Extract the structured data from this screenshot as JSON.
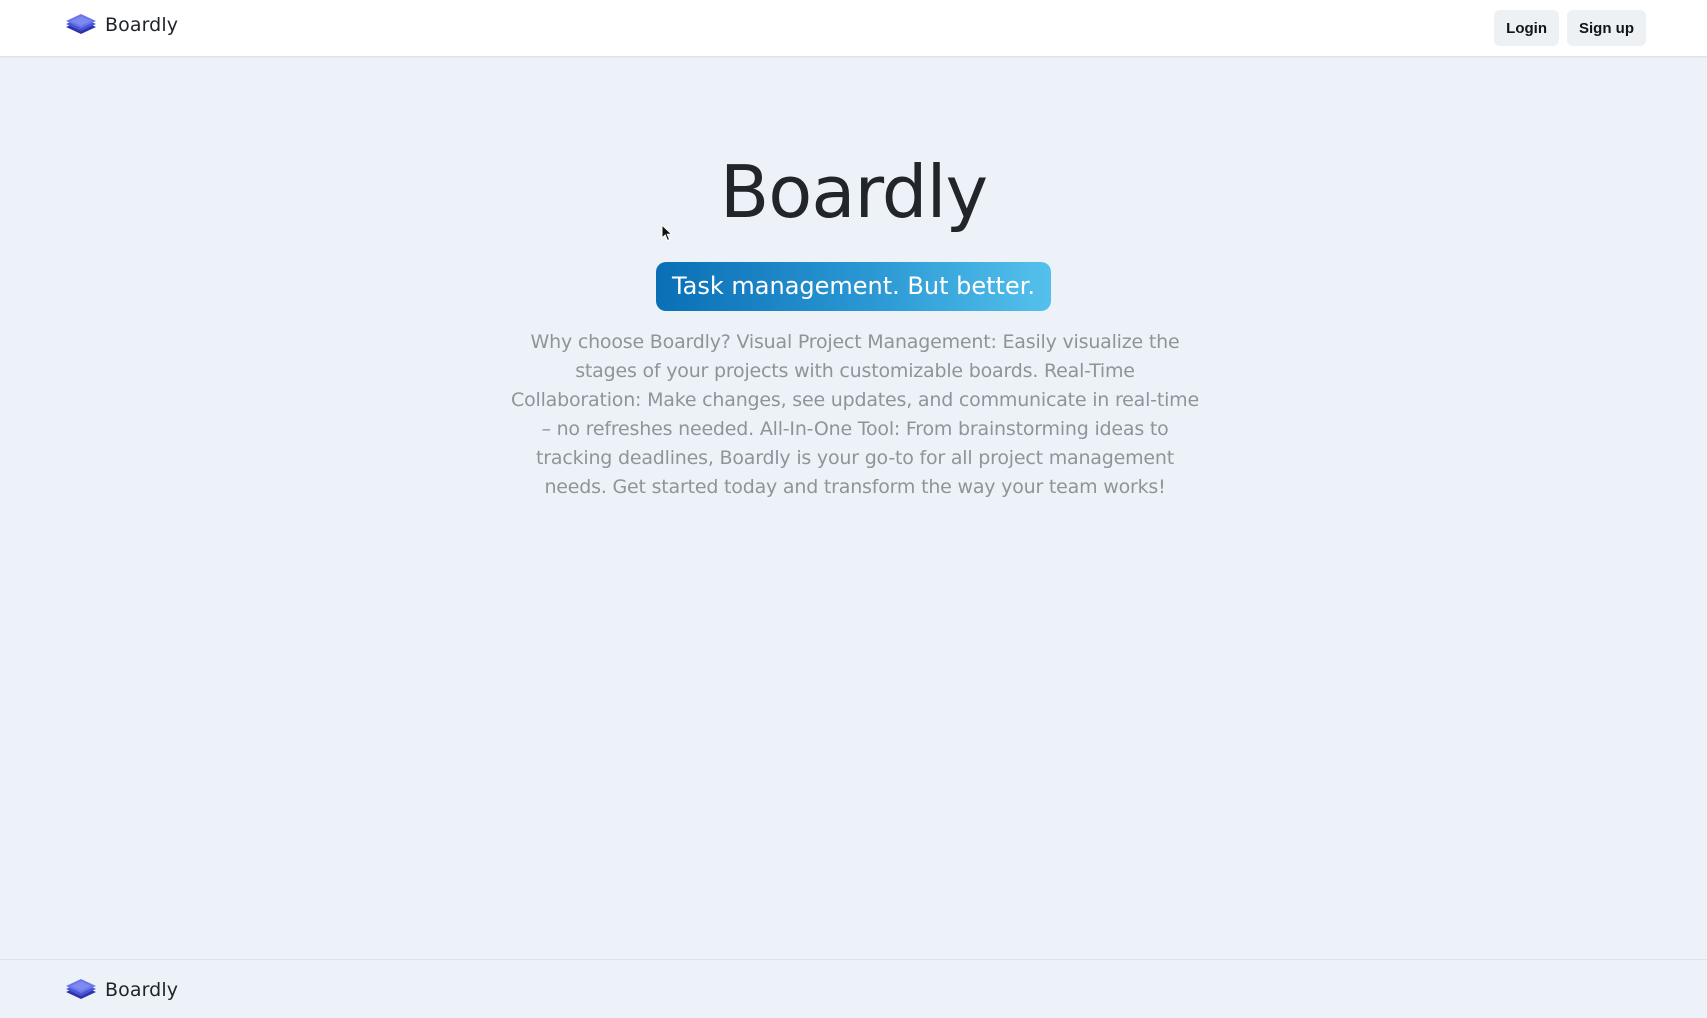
{
  "brand": {
    "name": "Boardly",
    "logo_icon": "stacked-layers-icon",
    "logo_color": "#3f4bd0"
  },
  "nav": {
    "login_label": "Login",
    "signup_label": "Sign up"
  },
  "hero": {
    "title": "Boardly",
    "tagline": "Task management. But better.",
    "description": "Why choose Boardly? Visual Project Management: Easily visualize the stages of your projects with customizable boards. Real-Time Collaboration: Make changes, see updates, and communicate in real-time – no refreshes needed. All-In-One Tool: From brainstorming ideas to tracking deadlines, Boardly is your go-to for all project management needs. Get started today and transform the way your team works!"
  },
  "footer": {
    "brand_name": "Boardly"
  },
  "colors": {
    "page_background": "#ecf2f7",
    "tagline_gradient_start": "#0a6fb5",
    "tagline_gradient_end": "#54c1ec"
  }
}
